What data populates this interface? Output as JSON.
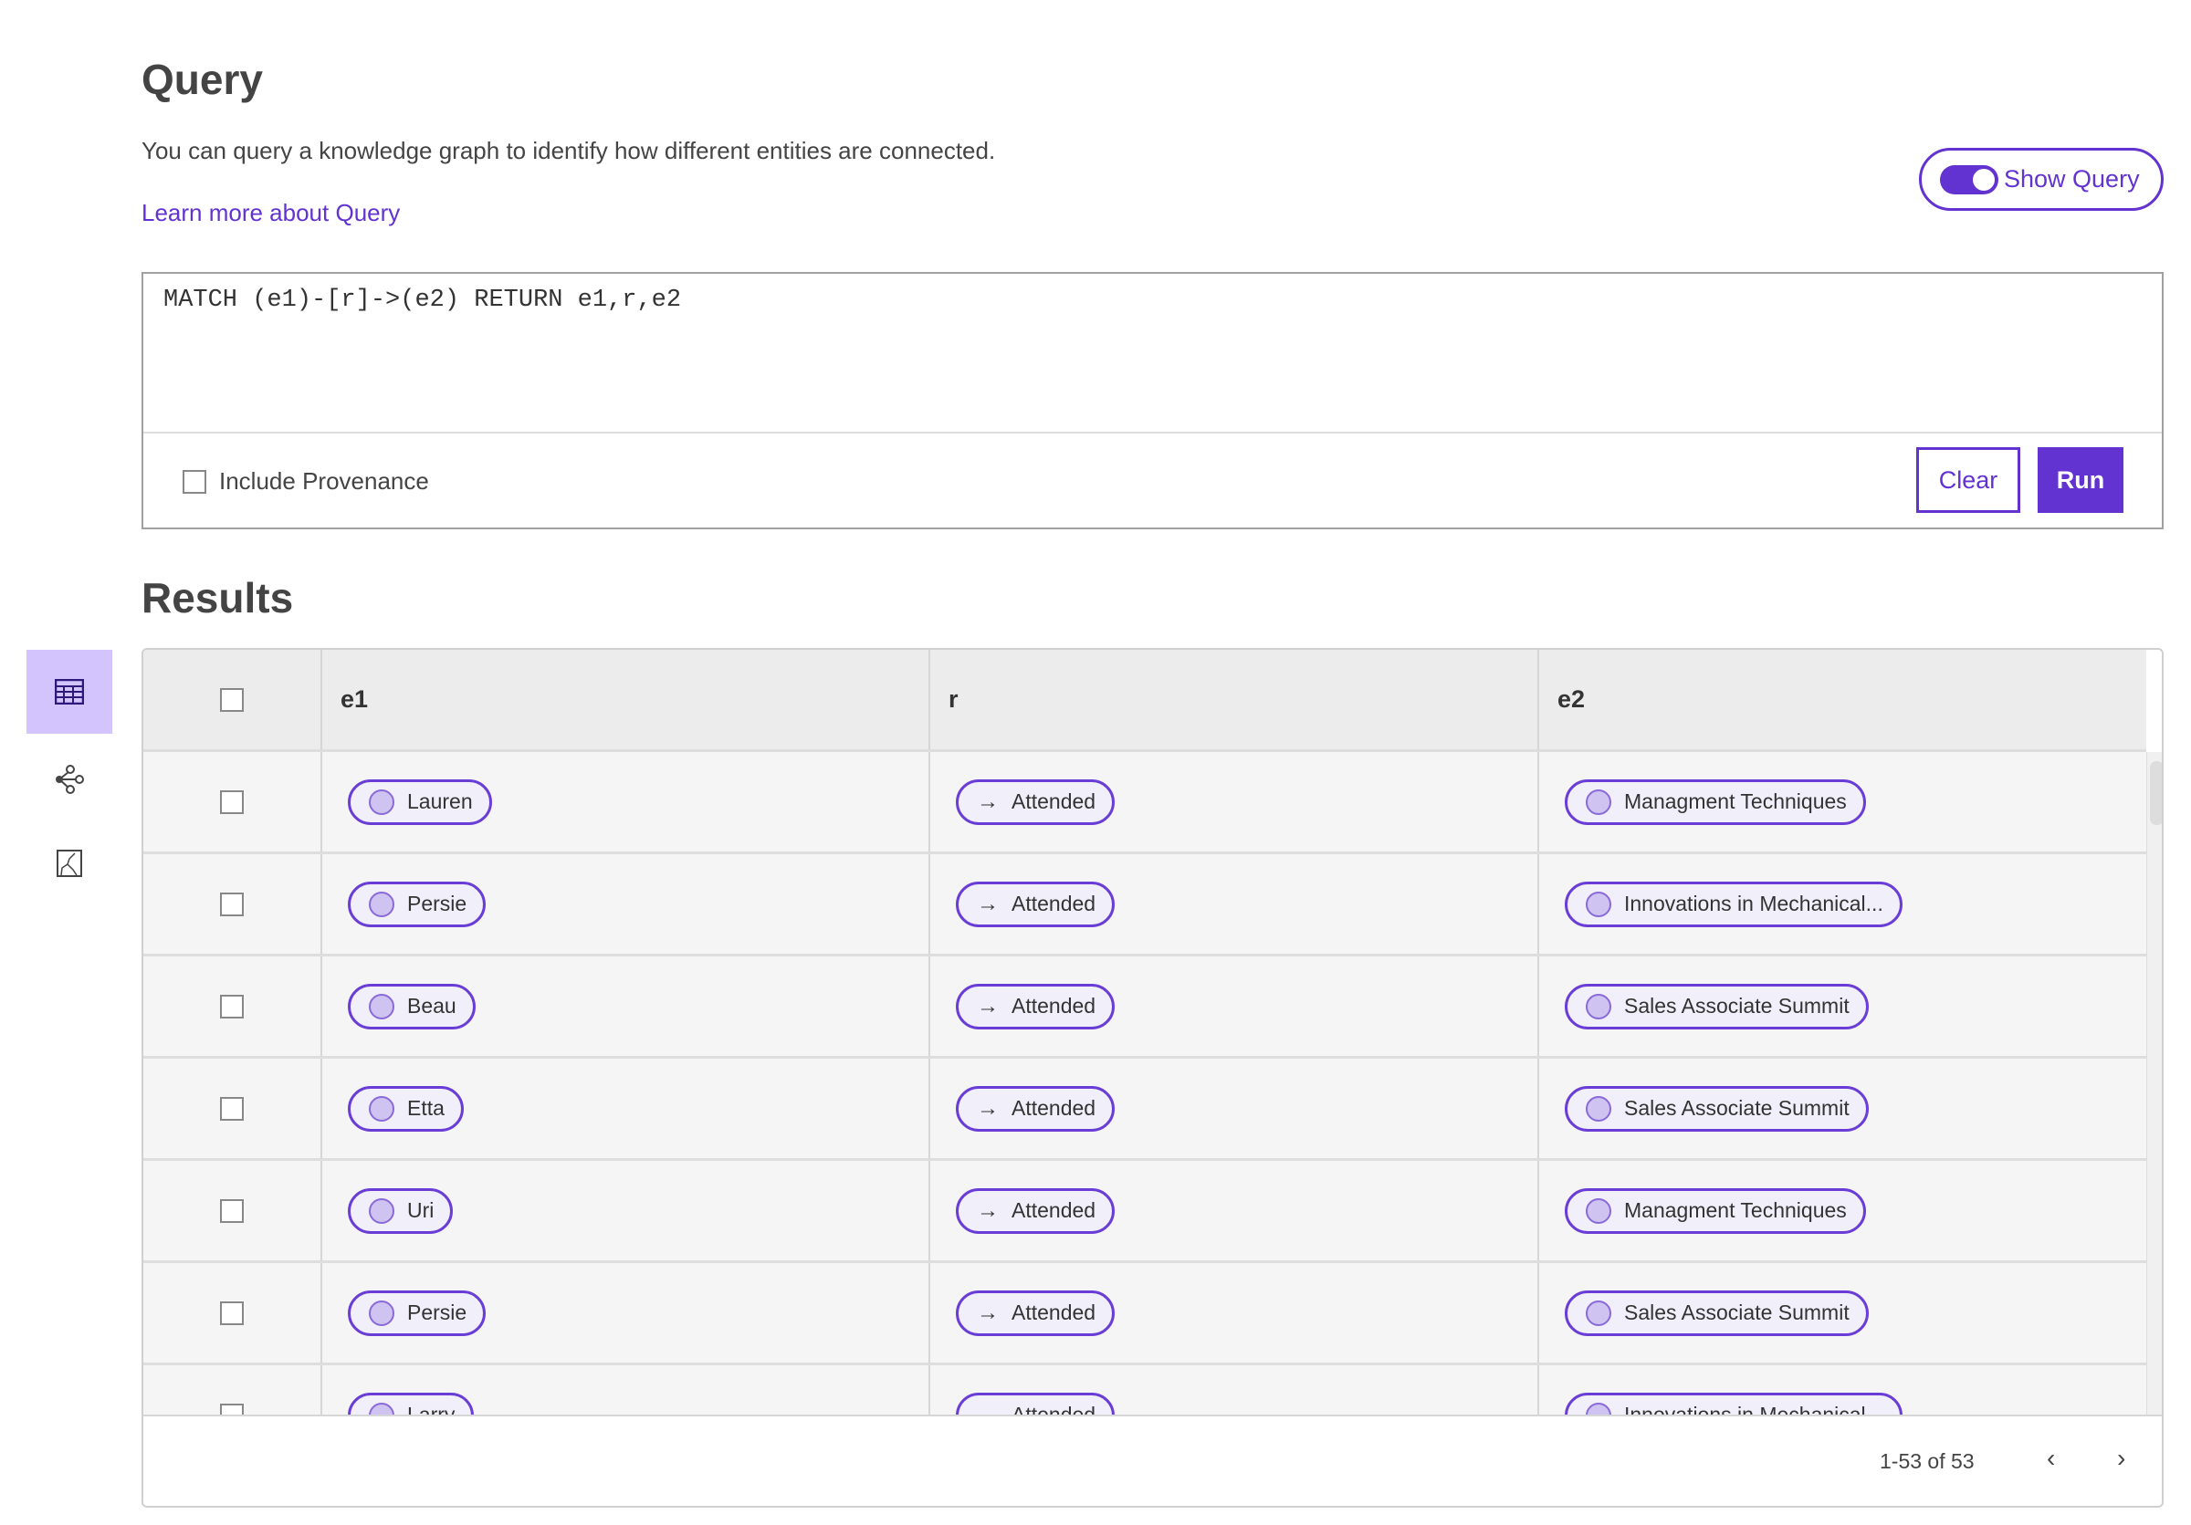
{
  "header": {
    "title": "Query",
    "description": "You can query a knowledge graph to identify how different entities are connected.",
    "learn_more": "Learn more about Query",
    "show_query_label": "Show Query",
    "show_query_on": true
  },
  "query": {
    "text": "MATCH (e1)-[r]->(e2) RETURN e1,r,e2",
    "include_provenance_label": "Include Provenance",
    "include_provenance": false,
    "clear_label": "Clear",
    "run_label": "Run"
  },
  "results": {
    "title": "Results",
    "columns": [
      "e1",
      "r",
      "e2"
    ],
    "rows": [
      {
        "e1": "Lauren",
        "r": "Attended",
        "e2": "Managment Techniques"
      },
      {
        "e1": "Persie",
        "r": "Attended",
        "e2": "Innovations in Mechanical..."
      },
      {
        "e1": "Beau",
        "r": "Attended",
        "e2": "Sales Associate Summit"
      },
      {
        "e1": "Etta",
        "r": "Attended",
        "e2": "Sales Associate Summit"
      },
      {
        "e1": "Uri",
        "r": "Attended",
        "e2": "Managment Techniques"
      },
      {
        "e1": "Persie",
        "r": "Attended",
        "e2": "Sales Associate Summit"
      },
      {
        "e1": "Larry",
        "r": "Attended",
        "e2": "Innovations in Mechanical..."
      }
    ],
    "pagination": "1-53 of 53"
  },
  "sidebar": {
    "items": [
      {
        "icon": "table-icon",
        "active": true
      },
      {
        "icon": "graph-icon",
        "active": false
      },
      {
        "icon": "chart-icon",
        "active": false
      }
    ]
  },
  "colors": {
    "accent": "#6233d1",
    "active_bg": "#d3c4fd"
  }
}
